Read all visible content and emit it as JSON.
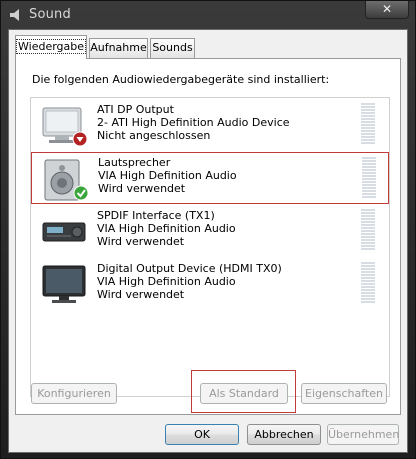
{
  "window": {
    "title": "Sound",
    "close_label": "✕"
  },
  "tabs": [
    {
      "label": "Wiedergabe",
      "active": true
    },
    {
      "label": "Aufnahme",
      "active": false
    },
    {
      "label": "Sounds",
      "active": false
    }
  ],
  "prompt": "Die folgenden Audiowiedergabegeräte sind installiert:",
  "devices": [
    {
      "name": "ATI DP Output",
      "driver": "2- ATI High Definition Audio Device",
      "status": "Nicht angeschlossen",
      "icon": "monitor-speaker-icon",
      "badge": "disconnected-icon",
      "selected": false
    },
    {
      "name": "Lautsprecher",
      "driver": "VIA High Definition Audio",
      "status": "Wird verwendet",
      "icon": "speaker-icon",
      "badge": "default-check-icon",
      "selected": true
    },
    {
      "name": "SPDIF Interface (TX1)",
      "driver": "VIA High Definition Audio",
      "status": "Wird verwendet",
      "icon": "receiver-icon",
      "badge": "",
      "selected": false
    },
    {
      "name": "Digital Output Device (HDMI TX0)",
      "driver": "VIA High Definition Audio",
      "status": "Wird verwendet",
      "icon": "tv-icon",
      "badge": "",
      "selected": false
    }
  ],
  "buttons": {
    "configure": "Konfigurieren",
    "set_default": "Als Standard",
    "properties": "Eigenschaften",
    "ok": "OK",
    "cancel": "Abbrechen",
    "apply": "Übernehmen"
  },
  "colors": {
    "selection_outline": "#c13b3b",
    "check_green": "#3aa53a",
    "disconnected_red": "#b22222"
  }
}
